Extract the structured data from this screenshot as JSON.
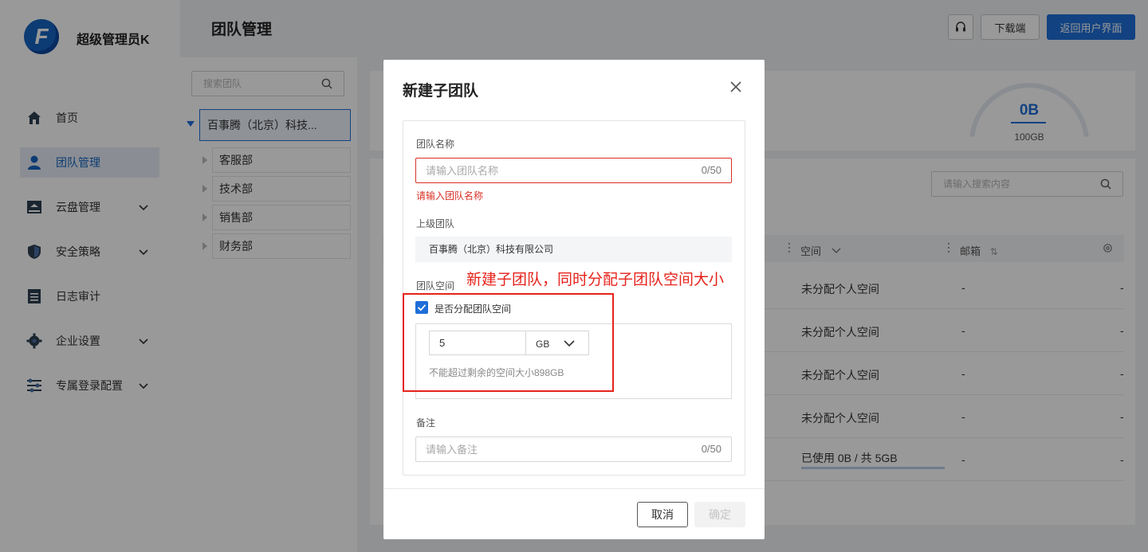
{
  "app": {
    "brand": "超级管理员K",
    "logo_letter": "F",
    "page_title": "团队管理",
    "header_buttons": {
      "download": "下载端",
      "back": "返回用户界面"
    }
  },
  "sidebar": {
    "items": [
      {
        "label": "首页",
        "icon": "home-icon",
        "active": false
      },
      {
        "label": "团队管理",
        "icon": "user-icon",
        "active": true
      },
      {
        "label": "云盘管理",
        "icon": "disk-icon",
        "active": false
      },
      {
        "label": "安全策略",
        "icon": "shield-icon",
        "active": false
      },
      {
        "label": "日志审计",
        "icon": "log-icon",
        "active": false
      },
      {
        "label": "企业设置",
        "icon": "gear-icon",
        "active": false
      },
      {
        "label": "专属登录配置",
        "icon": "config-icon",
        "active": false
      }
    ]
  },
  "tree": {
    "search_placeholder": "搜索团队",
    "root": "百事腾（北京）科技...",
    "children": [
      "客服部",
      "技术部",
      "销售部",
      "财务部"
    ]
  },
  "main": {
    "storage_used": "0B",
    "storage_total": "100GB",
    "search_placeholder": "请输入搜索内容",
    "columns": {
      "space": "空间",
      "email": "邮箱"
    },
    "rows": [
      {
        "space": "未分配个人空间",
        "email": "-",
        "extra": "-"
      },
      {
        "space": "未分配个人空间",
        "email": "-",
        "extra": "-"
      },
      {
        "space": "未分配个人空间",
        "email": "-",
        "extra": "-"
      },
      {
        "space": "未分配个人空间",
        "email": "-",
        "extra": "-"
      },
      {
        "space": "已使用 0B / 共 5GB",
        "email": "-",
        "extra": "-"
      }
    ]
  },
  "modal": {
    "title": "新建子团队",
    "name_label": "团队名称",
    "name_placeholder": "请输入团队名称",
    "name_counter": "0/50",
    "name_error": "请输入团队名称",
    "parent_label": "上级团队",
    "parent_value": "百事腾（北京）科技有限公司",
    "space_label": "团队空间",
    "allocate_checkbox_label": "是否分配团队空间",
    "allocate_checked": true,
    "space_value": "5",
    "space_unit": "GB",
    "space_hint": "不能超过剩余的空间大小898GB",
    "note_label": "备注",
    "note_placeholder": "请输入备注",
    "note_counter": "0/50",
    "cancel": "取消",
    "confirm": "确定"
  },
  "annotation": {
    "text": "新建子团队，同时分配子团队空间大小",
    "color": "#e5231b"
  },
  "colors": {
    "accent": "#1e6ed8",
    "error": "#d93026"
  }
}
